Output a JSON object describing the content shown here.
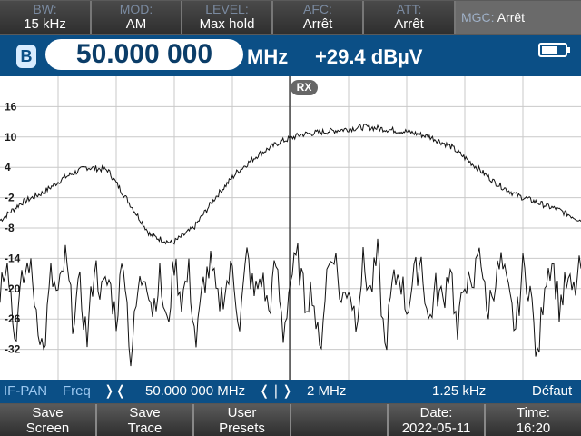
{
  "status_bar": {
    "cells": [
      {
        "label": "BW:",
        "value": "15 kHz"
      },
      {
        "label": "MOD:",
        "value": "AM"
      },
      {
        "label": "LEVEL:",
        "value": "Max hold"
      },
      {
        "label": "AFC:",
        "value": "Arrêt"
      },
      {
        "label": "ATT:",
        "value": "Arrêt"
      }
    ],
    "mgc": {
      "label": "MGC:",
      "value": "Arrêt"
    }
  },
  "frequency_bar": {
    "channel": "B",
    "frequency": "50.000 000",
    "unit": "MHz",
    "level": "+29.4 dBµV",
    "battery_level": 0.7
  },
  "plot": {
    "marker_label": "RX",
    "y_ticks": [
      "16",
      "10",
      "4",
      "-2",
      "-8",
      "-14",
      "-20",
      "-26",
      "-32"
    ]
  },
  "chart_data": {
    "type": "line",
    "y_ticks": [
      16,
      10,
      4,
      -2,
      -8,
      -14,
      -20,
      -26,
      -32
    ],
    "ylim": [
      -38,
      22
    ],
    "x_center_mhz": 50.0,
    "x_span_mhz": 2,
    "grid": true,
    "series": [
      {
        "role": "max-hold trace",
        "values": [
          -6.5,
          -3,
          -1,
          2,
          4,
          3.5,
          -3,
          -9.5,
          -11,
          -8,
          -2,
          3,
          6.5,
          9,
          10.5,
          11,
          11.5,
          12,
          11.5,
          11,
          10,
          8,
          4.5,
          1,
          -1.5,
          -3,
          -4.5,
          -6.5
        ]
      },
      {
        "role": "live noise trace",
        "values": [
          -20,
          -12.5,
          -30,
          -19.5,
          -14.5,
          -24,
          -33,
          -17.5,
          -22,
          -14,
          -25.5,
          -20,
          -30,
          -15,
          -21,
          -18.5,
          -26,
          -13,
          -34,
          -20.5,
          -16,
          -24,
          -18,
          -28,
          -14.5,
          -22,
          -17,
          -31,
          -19,
          -15.5,
          -23,
          -20,
          -16,
          -27,
          -13.5,
          -21.5,
          -17.5,
          -24.5,
          -15,
          -29,
          -18,
          -14,
          -22.5,
          -20,
          -33,
          -17,
          -12,
          -23,
          -19,
          -26,
          -15,
          -21,
          -13.5,
          -32,
          -20,
          -16.5,
          -24,
          -18,
          -14,
          -27,
          -20,
          -22.5,
          -14.5,
          -30,
          -17,
          -22,
          -10,
          -25,
          -19,
          -15,
          -21.5,
          -28,
          -16,
          -20,
          -35,
          -18,
          -14,
          -23.5,
          -19,
          -21,
          -15.5
        ]
      }
    ]
  },
  "info_bar": {
    "mode": "IF-PAN",
    "param": "Freq",
    "center_icon": "center-frequency-icon",
    "center": "50.000 000 MHz",
    "span_icon": "span-icon",
    "span": "2 MHz",
    "step": "1.25 kHz",
    "preset": "Défaut"
  },
  "softkeys": [
    {
      "line1": "Save",
      "line2": "Screen"
    },
    {
      "line1": "Save",
      "line2": "Trace"
    },
    {
      "line1": "User",
      "line2": "Presets"
    },
    {
      "line1": "",
      "line2": ""
    },
    {
      "line1": "Date:",
      "line2": "2022-05-11"
    },
    {
      "line1": "Time:",
      "line2": "16:20"
    }
  ]
}
